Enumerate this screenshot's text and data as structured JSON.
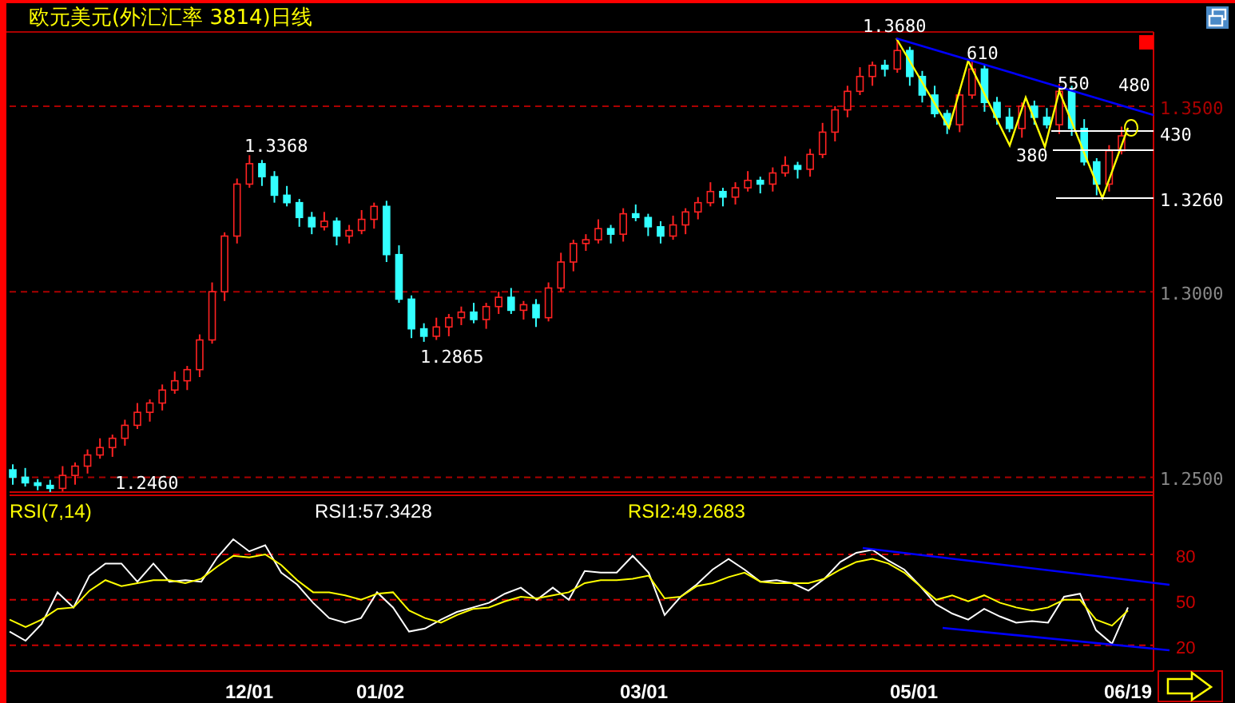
{
  "title": "欧元美元(外汇汇率 3814)日线",
  "price": {
    "annotations": [
      "1.3680",
      "610",
      "550",
      "480",
      "430",
      "380",
      "1.3260",
      "1.3368",
      "1.2865",
      "1.2460"
    ],
    "chart_data": {
      "type": "candlestick",
      "grid": true,
      "ylim": [
        1.246,
        1.37
      ],
      "yticks": [
        {
          "value": 1.35,
          "label": "1.3500"
        },
        {
          "value": 1.3,
          "label": "1.3000"
        },
        {
          "value": 1.25,
          "label": "1.2500"
        }
      ],
      "ohlc": [
        [
          1.252,
          1.2535,
          1.248,
          1.25
        ],
        [
          1.25,
          1.2525,
          1.2475,
          1.2485
        ],
        [
          1.2485,
          1.2495,
          1.2465,
          1.2478
        ],
        [
          1.2478,
          1.2493,
          1.246,
          1.247
        ],
        [
          1.247,
          1.253,
          1.2462,
          1.2505
        ],
        [
          1.2505,
          1.254,
          1.248,
          1.253
        ],
        [
          1.253,
          1.2575,
          1.251,
          1.256
        ],
        [
          1.256,
          1.2605,
          1.255,
          1.258
        ],
        [
          1.258,
          1.2615,
          1.2555,
          1.2605
        ],
        [
          1.2605,
          1.2655,
          1.2585,
          1.264
        ],
        [
          1.264,
          1.27,
          1.263,
          1.2675
        ],
        [
          1.2675,
          1.271,
          1.265,
          1.27
        ],
        [
          1.27,
          1.275,
          1.268,
          1.2735
        ],
        [
          1.2735,
          1.2785,
          1.2725,
          1.276
        ],
        [
          1.276,
          1.28,
          1.2735,
          1.279
        ],
        [
          1.279,
          1.2885,
          1.277,
          1.287
        ],
        [
          1.287,
          1.3025,
          1.286,
          1.3
        ],
        [
          1.3,
          1.316,
          1.2975,
          1.315
        ],
        [
          1.315,
          1.3305,
          1.313,
          1.329
        ],
        [
          1.329,
          1.3368,
          1.328,
          1.3345
        ],
        [
          1.3345,
          1.3355,
          1.3285,
          1.331
        ],
        [
          1.331,
          1.3325,
          1.324,
          1.326
        ],
        [
          1.326,
          1.3285,
          1.323,
          1.324
        ],
        [
          1.324,
          1.325,
          1.3175,
          1.32
        ],
        [
          1.32,
          1.3215,
          1.3155,
          1.3175
        ],
        [
          1.3175,
          1.3215,
          1.3165,
          1.319
        ],
        [
          1.319,
          1.32,
          1.3125,
          1.315
        ],
        [
          1.315,
          1.318,
          1.313,
          1.3165
        ],
        [
          1.3165,
          1.322,
          1.3155,
          1.3195
        ],
        [
          1.3195,
          1.324,
          1.317,
          1.323
        ],
        [
          1.323,
          1.3245,
          1.308,
          1.31
        ],
        [
          1.31,
          1.3125,
          1.297,
          1.298
        ],
        [
          1.298,
          1.299,
          1.2875,
          1.29
        ],
        [
          1.29,
          1.2915,
          1.2865,
          1.288
        ],
        [
          1.288,
          1.293,
          1.287,
          1.2905
        ],
        [
          1.2905,
          1.294,
          1.288,
          1.293
        ],
        [
          1.293,
          1.296,
          1.291,
          1.2945
        ],
        [
          1.2945,
          1.297,
          1.2915,
          1.2925
        ],
        [
          1.2925,
          1.297,
          1.29,
          1.296
        ],
        [
          1.296,
          1.3,
          1.294,
          1.2985
        ],
        [
          1.2985,
          1.301,
          1.294,
          1.295
        ],
        [
          1.295,
          1.2975,
          1.2925,
          1.2965
        ],
        [
          1.2965,
          1.298,
          1.2905,
          1.293
        ],
        [
          1.293,
          1.3025,
          1.292,
          1.301
        ],
        [
          1.301,
          1.3105,
          1.3,
          1.308
        ],
        [
          1.308,
          1.314,
          1.3055,
          1.313
        ],
        [
          1.313,
          1.3155,
          1.311,
          1.314
        ],
        [
          1.314,
          1.3195,
          1.313,
          1.317
        ],
        [
          1.317,
          1.318,
          1.313,
          1.3155
        ],
        [
          1.3155,
          1.3225,
          1.3135,
          1.321
        ],
        [
          1.321,
          1.3235,
          1.319,
          1.32
        ],
        [
          1.32,
          1.321,
          1.315,
          1.3175
        ],
        [
          1.3175,
          1.319,
          1.313,
          1.315
        ],
        [
          1.315,
          1.3205,
          1.314,
          1.318
        ],
        [
          1.318,
          1.3225,
          1.3155,
          1.3215
        ],
        [
          1.3215,
          1.3255,
          1.3195,
          1.324
        ],
        [
          1.324,
          1.3295,
          1.323,
          1.327
        ],
        [
          1.327,
          1.328,
          1.323,
          1.3255
        ],
        [
          1.3255,
          1.3295,
          1.3235,
          1.328
        ],
        [
          1.328,
          1.3325,
          1.327,
          1.33
        ],
        [
          1.33,
          1.331,
          1.3265,
          1.329
        ],
        [
          1.329,
          1.3335,
          1.327,
          1.332
        ],
        [
          1.332,
          1.3365,
          1.331,
          1.334
        ],
        [
          1.334,
          1.335,
          1.3305,
          1.333
        ],
        [
          1.333,
          1.3385,
          1.331,
          1.337
        ],
        [
          1.337,
          1.3455,
          1.336,
          1.343
        ],
        [
          1.343,
          1.35,
          1.3405,
          1.349
        ],
        [
          1.349,
          1.3555,
          1.347,
          1.354
        ],
        [
          1.354,
          1.3605,
          1.353,
          1.358
        ],
        [
          1.358,
          1.362,
          1.3555,
          1.361
        ],
        [
          1.361,
          1.3625,
          1.358,
          1.36
        ],
        [
          1.36,
          1.368,
          1.359,
          1.365
        ],
        [
          1.365,
          1.366,
          1.3555,
          1.358
        ],
        [
          1.358,
          1.3595,
          1.351,
          1.353
        ],
        [
          1.353,
          1.3555,
          1.347,
          1.348
        ],
        [
          1.348,
          1.349,
          1.3425,
          1.345
        ],
        [
          1.345,
          1.3545,
          1.343,
          1.353
        ],
        [
          1.353,
          1.3625,
          1.352,
          1.36
        ],
        [
          1.36,
          1.361,
          1.3485,
          1.351
        ],
        [
          1.351,
          1.3525,
          1.345,
          1.347
        ],
        [
          1.347,
          1.3495,
          1.343,
          1.344
        ],
        [
          1.344,
          1.351,
          1.3415,
          1.35
        ],
        [
          1.35,
          1.3515,
          1.345,
          1.347
        ],
        [
          1.347,
          1.3495,
          1.344,
          1.345
        ],
        [
          1.345,
          1.356,
          1.3425,
          1.354
        ],
        [
          1.354,
          1.3555,
          1.342,
          1.344
        ],
        [
          1.344,
          1.3465,
          1.334,
          1.335
        ],
        [
          1.335,
          1.336,
          1.326,
          1.329
        ],
        [
          1.329,
          1.3395,
          1.327,
          1.338
        ],
        [
          1.338,
          1.3445,
          1.337,
          1.342
        ]
      ]
    }
  },
  "rsi": {
    "name": "RSI(7,14)",
    "rsi1_value": ":57.3428",
    "rsi2_value": ":49.2683",
    "chart_data": {
      "type": "line",
      "grid": true,
      "ylim": [
        3,
        119
      ],
      "yticks": [
        80,
        50,
        20
      ],
      "series": [
        {
          "name": "RSI1",
          "color": "#ffffff",
          "values": [
            29,
            23,
            34,
            55,
            45,
            66,
            74,
            74,
            62,
            74,
            62,
            63,
            62,
            78,
            90,
            82,
            86,
            68,
            60,
            48,
            38,
            35,
            38,
            55,
            45,
            29,
            31,
            37,
            42,
            45,
            48,
            54,
            58,
            50,
            58,
            50,
            69,
            68,
            68,
            79,
            68,
            40,
            52,
            60,
            70,
            77,
            70,
            62,
            63,
            61,
            56,
            64,
            75,
            81,
            83,
            76,
            70,
            59,
            47,
            41,
            37,
            44,
            39,
            35,
            36,
            35,
            52,
            54,
            30,
            21,
            45
          ]
        },
        {
          "name": "RSI2",
          "color": "#ffff00",
          "values": [
            37,
            32,
            37,
            44,
            45,
            56,
            63,
            59,
            61,
            63,
            63,
            61,
            64,
            72,
            79,
            78,
            80,
            73,
            63,
            55,
            55,
            53,
            50,
            54,
            55,
            43,
            38,
            35,
            40,
            44,
            45,
            49,
            52,
            51,
            53,
            55,
            61,
            63,
            63,
            64,
            66,
            51,
            52,
            59,
            61,
            65,
            68,
            62,
            61,
            61,
            61,
            64,
            70,
            75,
            77,
            74,
            68,
            59,
            50,
            53,
            49,
            53,
            48,
            45,
            43,
            45,
            50,
            50,
            37,
            33,
            43
          ]
        }
      ]
    }
  },
  "date_axis": [
    "12/01",
    "01/02",
    "03/01",
    "05/01",
    "06/19"
  ]
}
